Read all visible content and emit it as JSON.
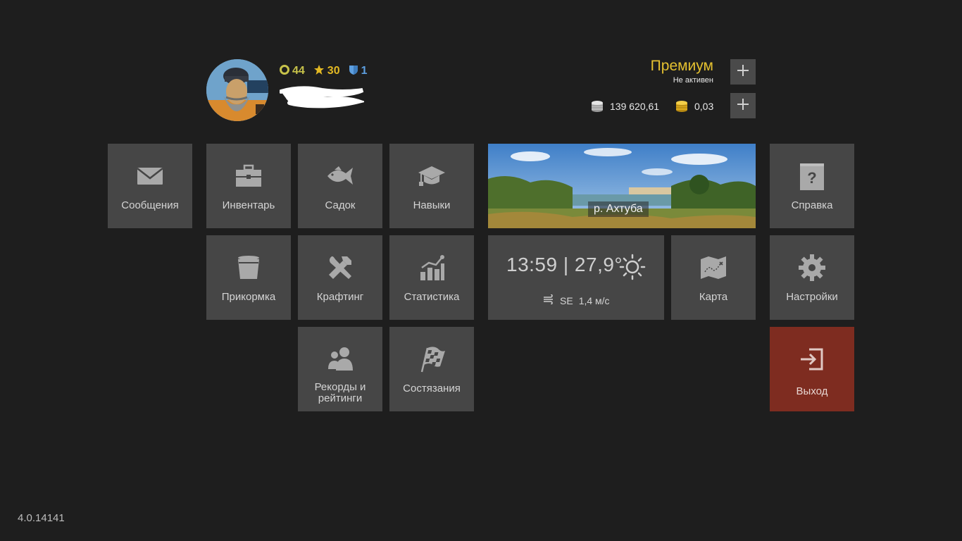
{
  "profile": {
    "level": "44",
    "rank": "30",
    "league": "1"
  },
  "premium": {
    "title": "Премиум",
    "status": "Не активен"
  },
  "currency": {
    "silver": "139 620,61",
    "gold": "0,03"
  },
  "tiles": {
    "messages": "Сообщения",
    "inventory": "Инвентарь",
    "keepnet": "Садок",
    "skills": "Навыки",
    "help": "Справка",
    "groundbait": "Прикормка",
    "crafting": "Крафтинг",
    "statistics": "Статистика",
    "map": "Карта",
    "settings": "Настройки",
    "records_line1": "Рекорды и",
    "records_line2": "рейтинги",
    "competitions": "Состязания",
    "exit": "Выход"
  },
  "location": {
    "name": "р. Ахтуба"
  },
  "weather": {
    "time": "13:59",
    "temperature": "27,9°",
    "wind_direction": "SE",
    "wind_speed": "1,4 м/с"
  },
  "version": "4.0.14141",
  "colors": {
    "background": "#1e1e1e",
    "tile": "#464646",
    "exit": "#7e2c20",
    "premium": "#e5c130"
  }
}
